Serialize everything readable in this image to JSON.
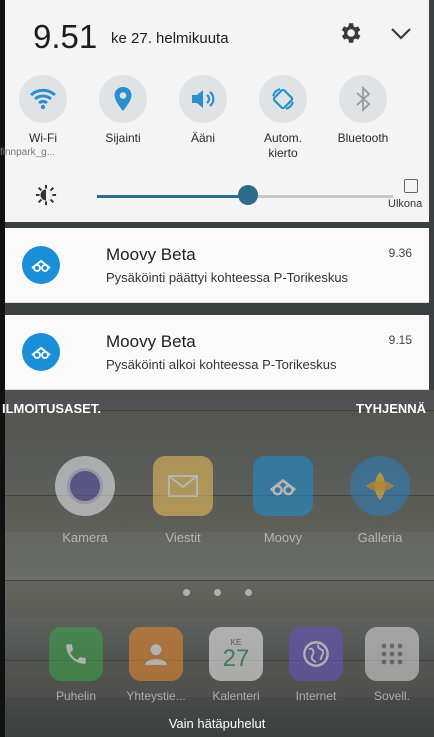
{
  "status": {
    "time": "9.51",
    "date": "ke 27. helmikuuta"
  },
  "quick_settings": [
    {
      "label": "Wi-Fi",
      "sub": "finnpark_g...",
      "icon": "wifi-icon"
    },
    {
      "label": "Sijainti",
      "icon": "location-pin-icon"
    },
    {
      "label": "Ääni",
      "icon": "speaker-icon"
    },
    {
      "label": "Autom. kierto",
      "icon": "auto-rotate-icon"
    },
    {
      "label": "Bluetooth",
      "icon": "bluetooth-icon"
    }
  ],
  "brightness": {
    "level": 0.51,
    "outdoor_label": "Ulkona",
    "outdoor_checked": false
  },
  "notifications": [
    {
      "app": "Moovy Beta",
      "time": "9.36",
      "text": "Pysäköinti päättyi kohteessa P-Torikeskus",
      "icon": "moovy-icon"
    },
    {
      "app": "Moovy Beta",
      "time": "9.15",
      "text": "Pysäköinti alkoi kohteessa P-Torikeskus",
      "icon": "moovy-icon"
    }
  ],
  "notification_actions": {
    "settings": "ILMOITUSASET.",
    "clear": "TYHJENNÄ"
  },
  "home_apps": [
    {
      "label": "Kamera",
      "icon": "camera-icon"
    },
    {
      "label": "Viestit",
      "icon": "messages-icon"
    },
    {
      "label": "Moovy",
      "icon": "moovy-icon"
    },
    {
      "label": "Galleria",
      "icon": "gallery-icon"
    }
  ],
  "dock_apps": [
    {
      "label": "Puhelin",
      "icon": "phone-icon"
    },
    {
      "label": "Yhteystie...",
      "icon": "contacts-icon"
    },
    {
      "label": "Kalenteri",
      "icon": "calendar-icon",
      "day_label": "KE",
      "day": "27"
    },
    {
      "label": "Internet",
      "icon": "internet-icon"
    },
    {
      "label": "Sovell.",
      "icon": "apps-grid-icon"
    }
  ],
  "emergency_label": "Vain hätäpuhelut",
  "colors": {
    "accent": "#2f6c8c",
    "moovy_blue": "#1a8fd7",
    "panel_bg": "#f4f4f4"
  }
}
